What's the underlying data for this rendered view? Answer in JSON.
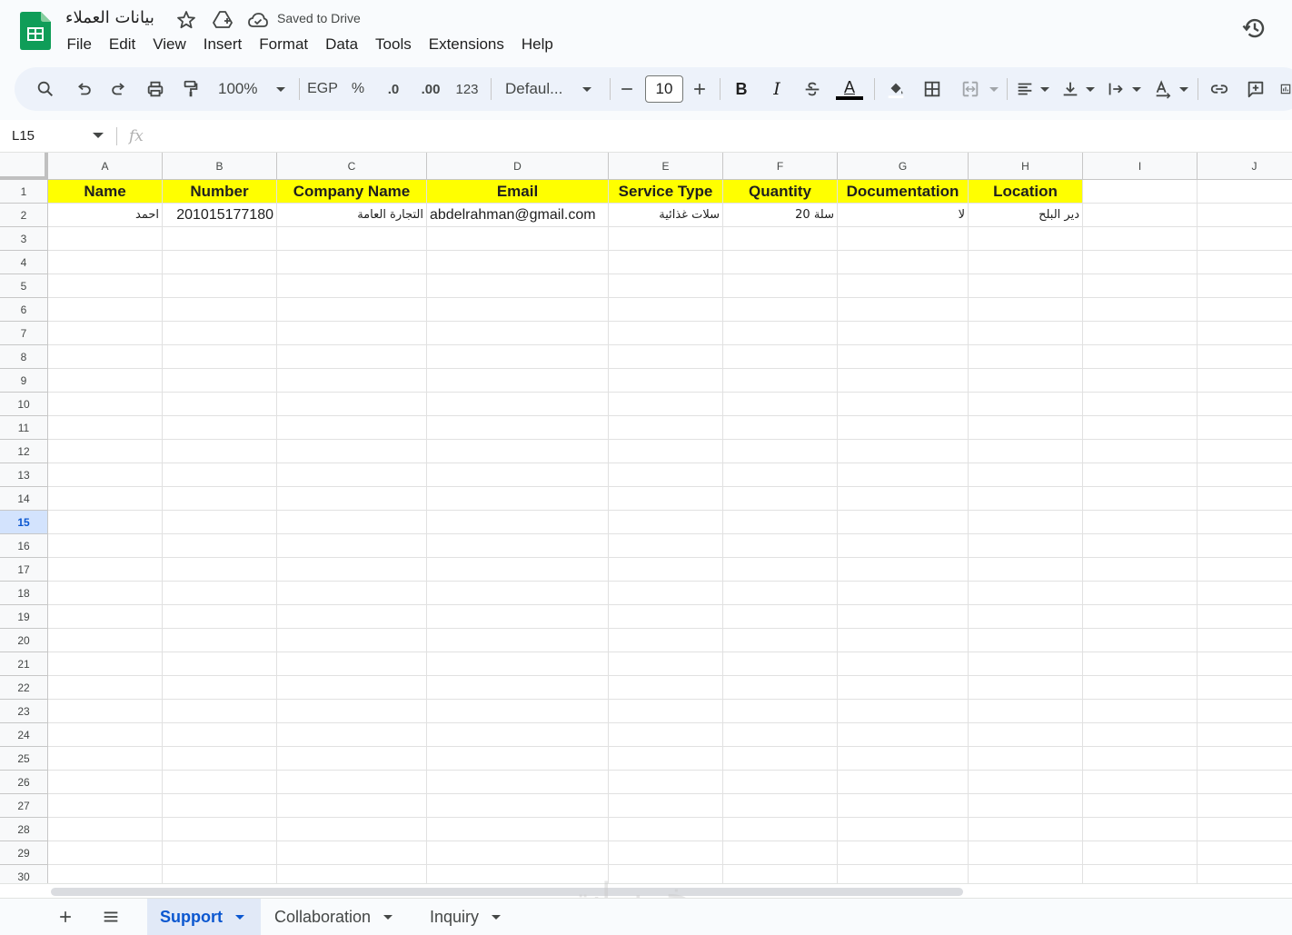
{
  "app": {
    "doc_title": "بيانات العملاء",
    "saved_status": "Saved to Drive",
    "menu": [
      "File",
      "Edit",
      "View",
      "Insert",
      "Format",
      "Data",
      "Tools",
      "Extensions",
      "Help"
    ]
  },
  "toolbar": {
    "zoom": "100%",
    "currency": "EGP",
    "percent": "%",
    "decrease_decimal": ".0",
    "increase_decimal": ".00",
    "number_format": "123",
    "font": "Defaul...",
    "font_size": "10",
    "bold": "B",
    "italic": "I",
    "text_color": "A"
  },
  "formula_bar": {
    "cell_ref": "L15",
    "fx": "fx"
  },
  "grid": {
    "columns": [
      "A",
      "B",
      "C",
      "D",
      "E",
      "F",
      "G",
      "H",
      "I",
      "J"
    ],
    "active_row": 15,
    "header_row": [
      "Name",
      "Number",
      "Company Name",
      "Email",
      "Service Type",
      "Quantity",
      "Documentation",
      "Location"
    ],
    "row2": [
      "احمد",
      "201015177180",
      "التجارة العامة",
      "abdelrahman@gmail.com",
      "سلات غذائية",
      "20 سلة",
      "لا",
      "دير البلح"
    ]
  },
  "sheets": [
    {
      "name": "Support",
      "active": true
    },
    {
      "name": "Collaboration",
      "active": false
    },
    {
      "name": "Inquiry",
      "active": false
    }
  ],
  "watermark": "خمسات",
  "colors": {
    "header_fill": "#ffff00",
    "accent": "#0b57d0",
    "sheets_green": "#0f9d58"
  }
}
